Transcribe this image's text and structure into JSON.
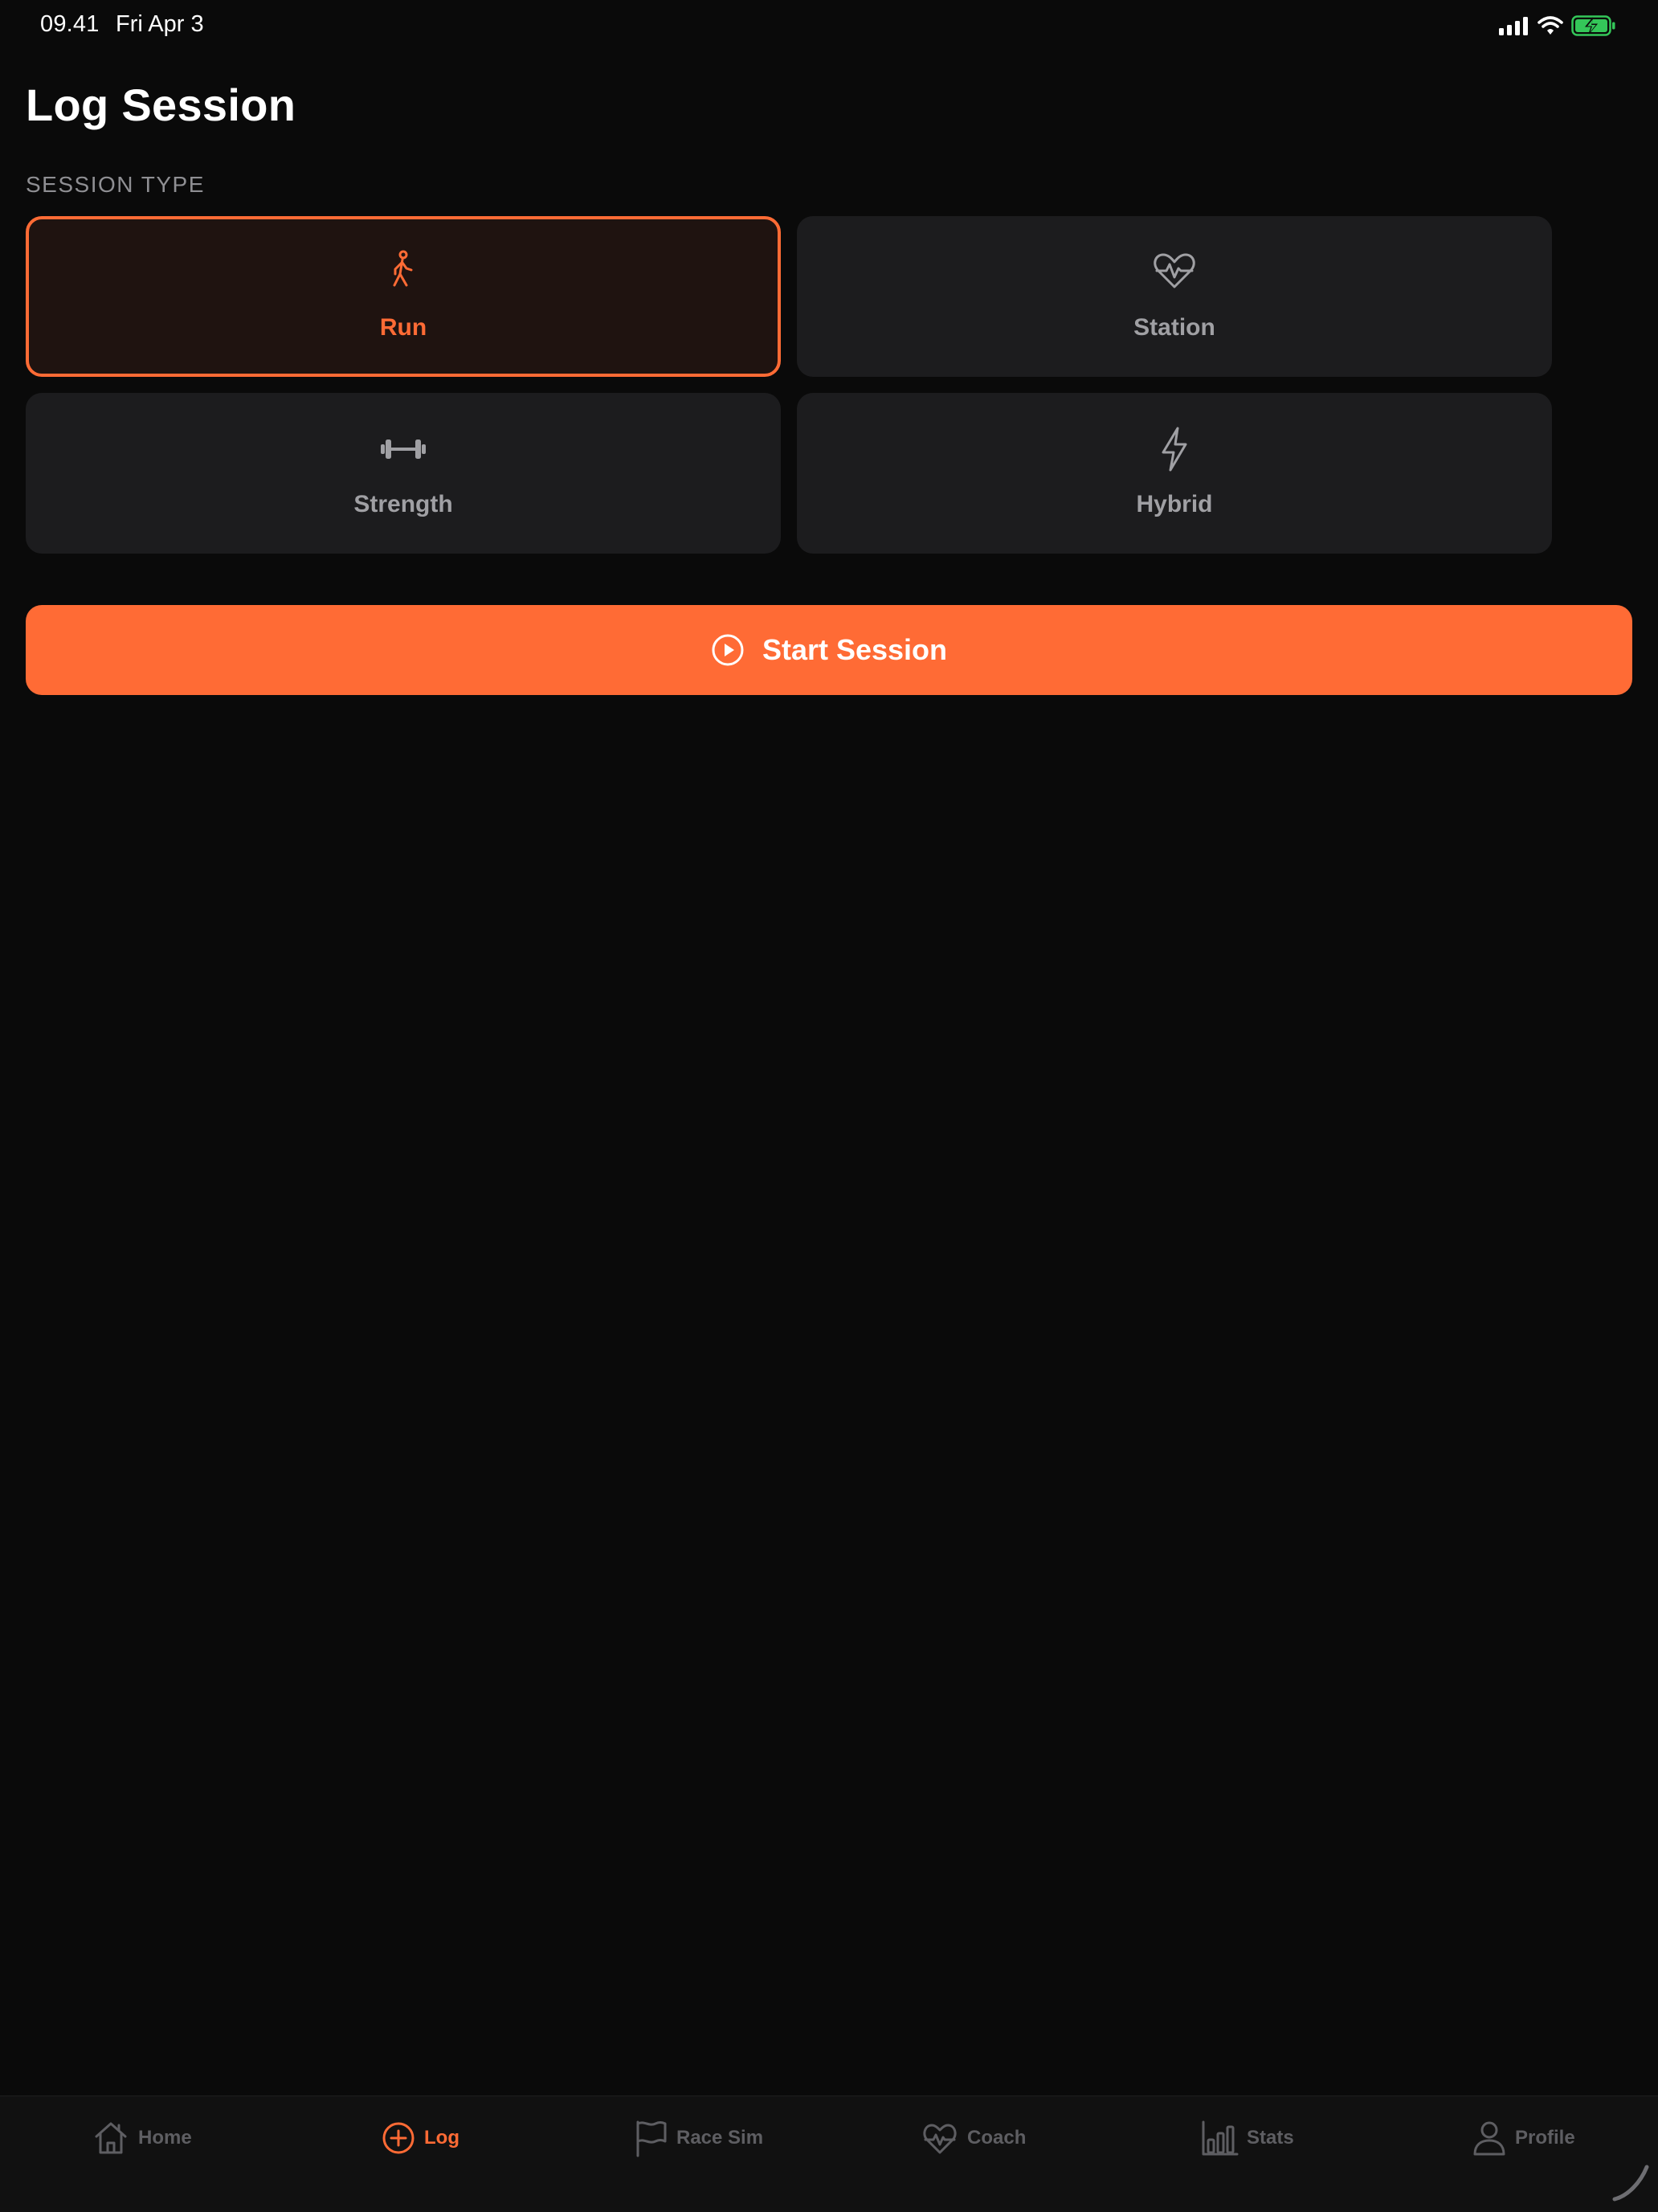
{
  "status_bar": {
    "time": "09.41",
    "date": "Fri Apr 3",
    "battery_color": "#34c759"
  },
  "header": {
    "title": "Log Session"
  },
  "session_type": {
    "label": "SESSION TYPE",
    "selected": "Run",
    "options": [
      {
        "label": "Run",
        "icon": "figure-walk-icon"
      },
      {
        "label": "Station",
        "icon": "heart-pulse-icon"
      },
      {
        "label": "Strength",
        "icon": "dumbbell-icon"
      },
      {
        "label": "Hybrid",
        "icon": "bolt-icon"
      }
    ]
  },
  "start_button": {
    "label": "Start Session",
    "icon": "play-circle-icon"
  },
  "tab_bar": {
    "active": "Log",
    "items": [
      {
        "label": "Home",
        "icon": "house-icon"
      },
      {
        "label": "Log",
        "icon": "plus-circle-icon"
      },
      {
        "label": "Race Sim",
        "icon": "flag-icon"
      },
      {
        "label": "Coach",
        "icon": "heart-pulse-icon"
      },
      {
        "label": "Stats",
        "icon": "bar-chart-icon"
      },
      {
        "label": "Profile",
        "icon": "person-icon"
      }
    ]
  },
  "colors": {
    "accent": "#ff6b35",
    "background": "#0a0a0a",
    "card": "#1c1c1e",
    "muted_text": "#8f8f93"
  }
}
